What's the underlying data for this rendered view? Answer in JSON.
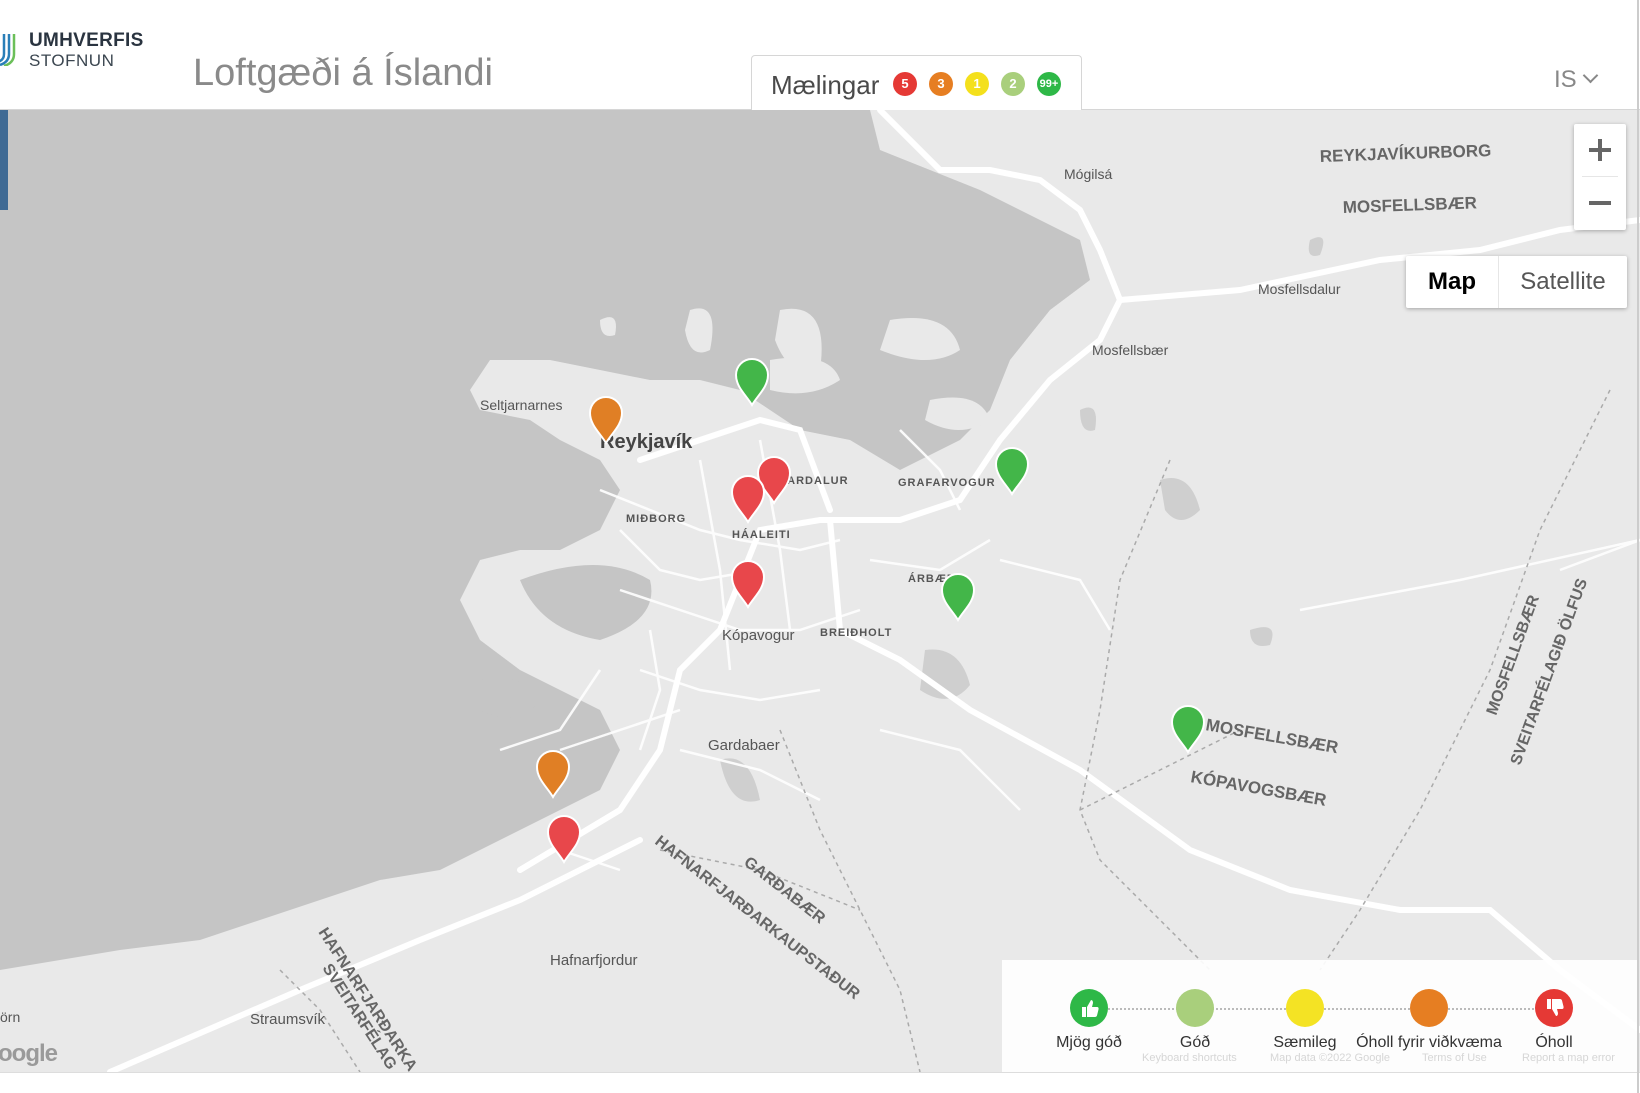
{
  "header": {
    "logo_line1": "UMHVERFIS",
    "logo_line2": "STOFNUN",
    "title": "Loftgæði á Íslandi",
    "measurements_label": "Mælingar",
    "badges": [
      {
        "count": "5",
        "color": "#e53935"
      },
      {
        "count": "3",
        "color": "#e67e22"
      },
      {
        "count": "1",
        "color": "#f4e01c"
      },
      {
        "count": "2",
        "color": "#a9cf7c"
      },
      {
        "count": "99+",
        "color": "#2eb847"
      }
    ],
    "language": "IS"
  },
  "map": {
    "map_type_options": [
      "Map",
      "Satellite"
    ],
    "selected_map_type": "Map",
    "place_labels": {
      "mogilsa": "Mógilsá",
      "reykjavikurborg": "REYKJAVÍKURBORG",
      "mosfellsbaer_top": "MOSFELLSBÆR",
      "mosfellsdalur": "Mosfellsdalur",
      "mosfellsbaer_town": "Mosfellsbær",
      "seltjarnarnes": "Seltjarnarnes",
      "reykjavik": "Reykjavík",
      "laugardalur": "LAUGARDALUR",
      "grafarvogur": "GRAFARVOGUR",
      "midborg": "MIÐBORG",
      "haaleiti": "HÁALEITI",
      "arbaer": "ÁRBÆR",
      "kopavogur": "Kópavogur",
      "breidholt": "BREIÐHOLT",
      "gardabaer": "Gardabaer",
      "mosfellsbaer_mid": "MOSFELLSBÆR",
      "kopavogsbaer": "KÓPAVOGSBÆR",
      "mosfellsbaer_vert": "MOSFELLSBÆR",
      "sveitarfelagid_olfus": "SVEITARFÉLAGIÐ ÖLFUS",
      "gardabaer_caps": "GARÐABÆR",
      "hafnarfjardarkaupstadur": "HAFNARFJARÐARKAUPSTAÐUR",
      "hafnarfjordur": "Hafnarfjordur",
      "straumsvik": "Straumsvík",
      "hafnarfjardarka": "HAFNARFJARÐARKA",
      "sveitarfelag": "SVEITARFÉLAG",
      "orn": "örn"
    },
    "stations": [
      {
        "status": "very-good",
        "color": "#43b649"
      },
      {
        "status": "poor-sensitive",
        "color": "#e07f25"
      },
      {
        "status": "unhealthy",
        "color": "#e8474b"
      },
      {
        "status": "unhealthy",
        "color": "#e8474b"
      },
      {
        "status": "very-good",
        "color": "#43b649"
      },
      {
        "status": "unhealthy",
        "color": "#e8474b"
      },
      {
        "status": "very-good",
        "color": "#43b649"
      },
      {
        "status": "very-good",
        "color": "#43b649"
      },
      {
        "status": "poor-sensitive",
        "color": "#e07f25"
      },
      {
        "status": "unhealthy",
        "color": "#e8474b"
      }
    ],
    "google_logo": "oogle",
    "legend": {
      "items": [
        {
          "label": "Mjög góð",
          "color": "#2eb847",
          "icon": "thumbs-up-icon"
        },
        {
          "label": "Góð",
          "color": "#a9cf7c"
        },
        {
          "label": "Sæmileg",
          "color": "#f4e324"
        },
        {
          "label": "Óholl fyrir viðkvæma",
          "color": "#e67e22"
        },
        {
          "label": "Óholl",
          "color": "#e53935",
          "icon": "thumbs-down-icon"
        }
      ],
      "attribution": [
        "Keyboard shortcuts",
        "Map data ©2022 Google",
        "Terms of Use",
        "Report a map error"
      ]
    }
  }
}
